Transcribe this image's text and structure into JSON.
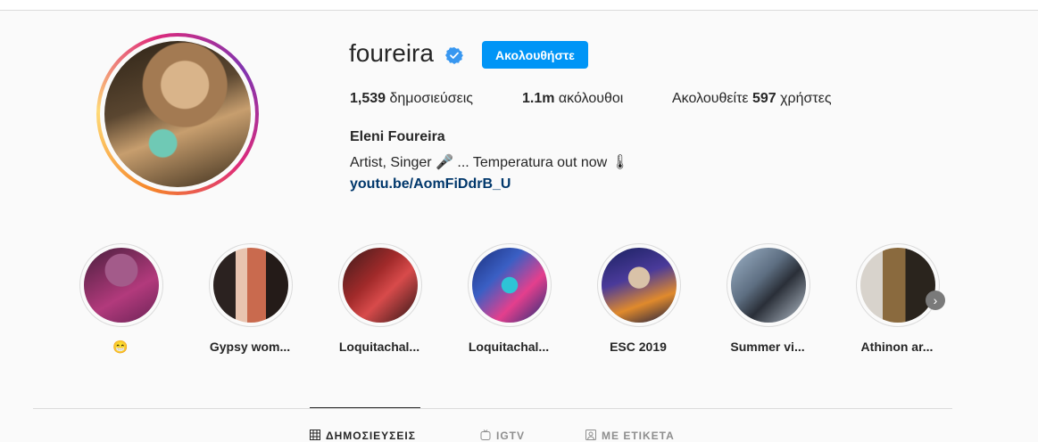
{
  "profile": {
    "username": "foureira",
    "verified_icon": "verified-badge-icon",
    "follow_label": "Ακολουθήστε",
    "stats": {
      "posts_value": "1,539",
      "posts_label": "δημοσιεύσεις",
      "followers_value": "1.1m",
      "followers_label": "ακόλουθοι",
      "following_prefix": "Ακολουθείτε",
      "following_value": "597",
      "following_suffix": "χρήστες"
    },
    "full_name": "Eleni Foureira",
    "bio": "Artist, Singer 🎤 ... Temperatura out now 🌡",
    "link": "youtu.be/AomFiDdrB_U"
  },
  "highlights": [
    {
      "label": "😁"
    },
    {
      "label": "Gypsy wom..."
    },
    {
      "label": "Loquitachal..."
    },
    {
      "label": "Loquitachal..."
    },
    {
      "label": "ESC 2019"
    },
    {
      "label": "Summer vi..."
    },
    {
      "label": "Athinon ar..."
    }
  ],
  "tabs": [
    {
      "label": "ΔΗΜΟΣΙΕΥΣΕΙΣ",
      "icon": "grid-icon"
    },
    {
      "label": "IGTV",
      "icon": "igtv-icon"
    },
    {
      "label": "ΜΕ ΕΤΙΚΕΤΑ",
      "icon": "tagged-icon"
    }
  ],
  "colors": {
    "accent": "#0095f6",
    "link": "#00376b",
    "background": "#fafafa"
  }
}
